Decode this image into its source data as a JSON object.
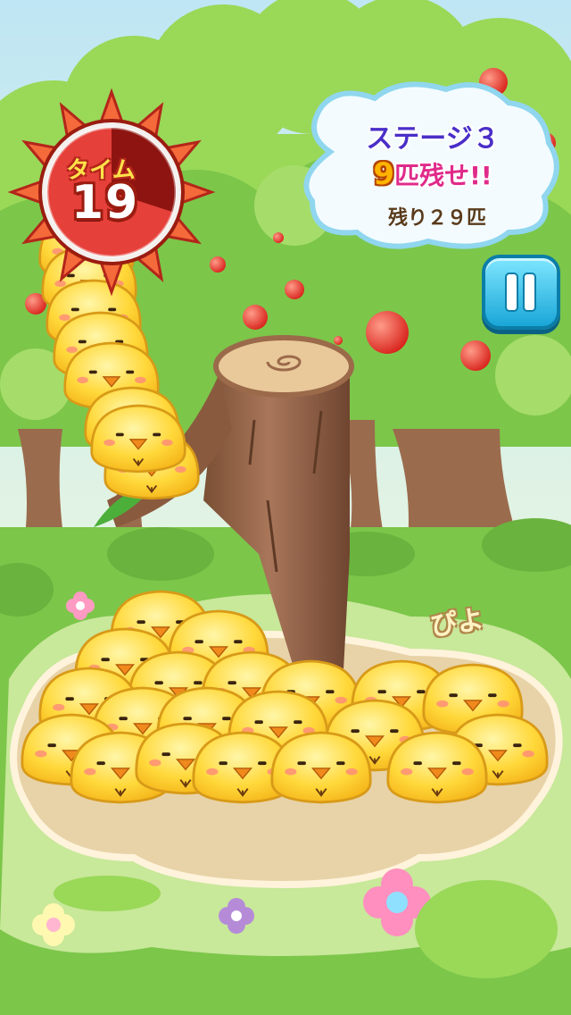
{
  "hud": {
    "timer_label": "タイム",
    "timer_value": "19",
    "timer_remaining_fraction": 0.3,
    "stage_title": "ステージ３",
    "goal_number": "9",
    "goal_text": "匹残せ!!",
    "remaining_text": "残り２９匹"
  },
  "decor": {
    "piyo_label": "ぴよ"
  },
  "colors": {
    "sky": "#bfe6f4",
    "grass": "#7cc64a",
    "chick_body": "#ffd83a",
    "chick_cheek": "#ff8a7a",
    "beak": "#f08a1c",
    "stump": "#9b6a4a",
    "timer_ring": "#e6403a"
  },
  "icons": {
    "pause": "pause-icon",
    "timer": "sun-timer-icon"
  }
}
